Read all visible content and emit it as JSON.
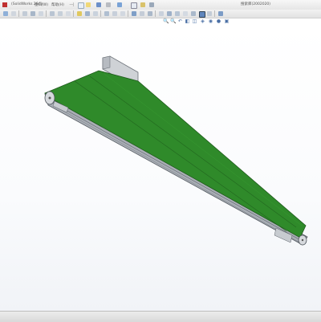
{
  "menubar": {
    "items": [
      "(SolidWorks 2&6)",
      "窗口(W)",
      "帮助(H)"
    ],
    "search_placeholder": "搜索库(2002020)"
  },
  "toolbar": {
    "icons": [
      "new-icon",
      "open-icon",
      "save-icon",
      "print-icon",
      "undo-icon",
      "select-icon",
      "rebuild-icon",
      "options-icon",
      "sketch-icon"
    ]
  },
  "viewbar": {
    "icons": [
      "zoom-fit",
      "zoom-area",
      "previous-view",
      "section-view",
      "view-orientation",
      "display-style",
      "hide-show",
      "appearance",
      "scene"
    ]
  },
  "colors": {
    "belt": "#2f8a2a",
    "frame": "#9aa0a8",
    "background": "#ffffff"
  }
}
